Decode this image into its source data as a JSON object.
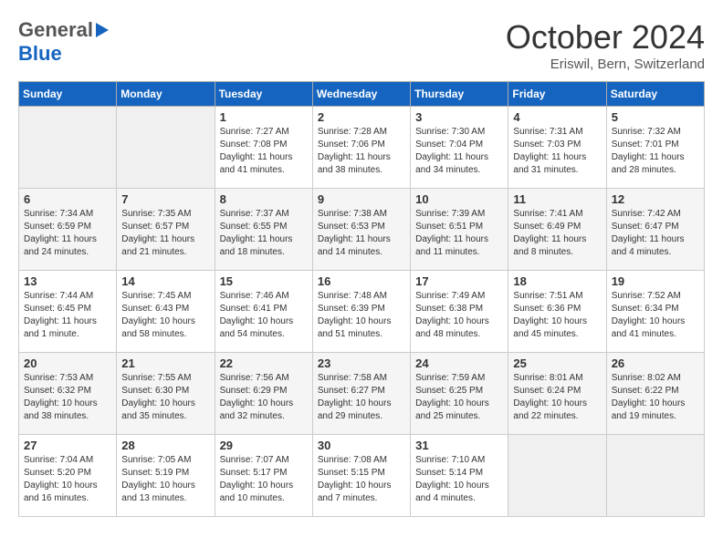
{
  "header": {
    "logo_general": "General",
    "logo_blue": "Blue",
    "month_title": "October 2024",
    "location": "Eriswil, Bern, Switzerland"
  },
  "days_of_week": [
    "Sunday",
    "Monday",
    "Tuesday",
    "Wednesday",
    "Thursday",
    "Friday",
    "Saturday"
  ],
  "weeks": [
    [
      {
        "day": "",
        "empty": true
      },
      {
        "day": "",
        "empty": true
      },
      {
        "day": "1",
        "sunrise": "Sunrise: 7:27 AM",
        "sunset": "Sunset: 7:08 PM",
        "daylight": "Daylight: 11 hours and 41 minutes."
      },
      {
        "day": "2",
        "sunrise": "Sunrise: 7:28 AM",
        "sunset": "Sunset: 7:06 PM",
        "daylight": "Daylight: 11 hours and 38 minutes."
      },
      {
        "day": "3",
        "sunrise": "Sunrise: 7:30 AM",
        "sunset": "Sunset: 7:04 PM",
        "daylight": "Daylight: 11 hours and 34 minutes."
      },
      {
        "day": "4",
        "sunrise": "Sunrise: 7:31 AM",
        "sunset": "Sunset: 7:03 PM",
        "daylight": "Daylight: 11 hours and 31 minutes."
      },
      {
        "day": "5",
        "sunrise": "Sunrise: 7:32 AM",
        "sunset": "Sunset: 7:01 PM",
        "daylight": "Daylight: 11 hours and 28 minutes."
      }
    ],
    [
      {
        "day": "6",
        "sunrise": "Sunrise: 7:34 AM",
        "sunset": "Sunset: 6:59 PM",
        "daylight": "Daylight: 11 hours and 24 minutes."
      },
      {
        "day": "7",
        "sunrise": "Sunrise: 7:35 AM",
        "sunset": "Sunset: 6:57 PM",
        "daylight": "Daylight: 11 hours and 21 minutes."
      },
      {
        "day": "8",
        "sunrise": "Sunrise: 7:37 AM",
        "sunset": "Sunset: 6:55 PM",
        "daylight": "Daylight: 11 hours and 18 minutes."
      },
      {
        "day": "9",
        "sunrise": "Sunrise: 7:38 AM",
        "sunset": "Sunset: 6:53 PM",
        "daylight": "Daylight: 11 hours and 14 minutes."
      },
      {
        "day": "10",
        "sunrise": "Sunrise: 7:39 AM",
        "sunset": "Sunset: 6:51 PM",
        "daylight": "Daylight: 11 hours and 11 minutes."
      },
      {
        "day": "11",
        "sunrise": "Sunrise: 7:41 AM",
        "sunset": "Sunset: 6:49 PM",
        "daylight": "Daylight: 11 hours and 8 minutes."
      },
      {
        "day": "12",
        "sunrise": "Sunrise: 7:42 AM",
        "sunset": "Sunset: 6:47 PM",
        "daylight": "Daylight: 11 hours and 4 minutes."
      }
    ],
    [
      {
        "day": "13",
        "sunrise": "Sunrise: 7:44 AM",
        "sunset": "Sunset: 6:45 PM",
        "daylight": "Daylight: 11 hours and 1 minute."
      },
      {
        "day": "14",
        "sunrise": "Sunrise: 7:45 AM",
        "sunset": "Sunset: 6:43 PM",
        "daylight": "Daylight: 10 hours and 58 minutes."
      },
      {
        "day": "15",
        "sunrise": "Sunrise: 7:46 AM",
        "sunset": "Sunset: 6:41 PM",
        "daylight": "Daylight: 10 hours and 54 minutes."
      },
      {
        "day": "16",
        "sunrise": "Sunrise: 7:48 AM",
        "sunset": "Sunset: 6:39 PM",
        "daylight": "Daylight: 10 hours and 51 minutes."
      },
      {
        "day": "17",
        "sunrise": "Sunrise: 7:49 AM",
        "sunset": "Sunset: 6:38 PM",
        "daylight": "Daylight: 10 hours and 48 minutes."
      },
      {
        "day": "18",
        "sunrise": "Sunrise: 7:51 AM",
        "sunset": "Sunset: 6:36 PM",
        "daylight": "Daylight: 10 hours and 45 minutes."
      },
      {
        "day": "19",
        "sunrise": "Sunrise: 7:52 AM",
        "sunset": "Sunset: 6:34 PM",
        "daylight": "Daylight: 10 hours and 41 minutes."
      }
    ],
    [
      {
        "day": "20",
        "sunrise": "Sunrise: 7:53 AM",
        "sunset": "Sunset: 6:32 PM",
        "daylight": "Daylight: 10 hours and 38 minutes."
      },
      {
        "day": "21",
        "sunrise": "Sunrise: 7:55 AM",
        "sunset": "Sunset: 6:30 PM",
        "daylight": "Daylight: 10 hours and 35 minutes."
      },
      {
        "day": "22",
        "sunrise": "Sunrise: 7:56 AM",
        "sunset": "Sunset: 6:29 PM",
        "daylight": "Daylight: 10 hours and 32 minutes."
      },
      {
        "day": "23",
        "sunrise": "Sunrise: 7:58 AM",
        "sunset": "Sunset: 6:27 PM",
        "daylight": "Daylight: 10 hours and 29 minutes."
      },
      {
        "day": "24",
        "sunrise": "Sunrise: 7:59 AM",
        "sunset": "Sunset: 6:25 PM",
        "daylight": "Daylight: 10 hours and 25 minutes."
      },
      {
        "day": "25",
        "sunrise": "Sunrise: 8:01 AM",
        "sunset": "Sunset: 6:24 PM",
        "daylight": "Daylight: 10 hours and 22 minutes."
      },
      {
        "day": "26",
        "sunrise": "Sunrise: 8:02 AM",
        "sunset": "Sunset: 6:22 PM",
        "daylight": "Daylight: 10 hours and 19 minutes."
      }
    ],
    [
      {
        "day": "27",
        "sunrise": "Sunrise: 7:04 AM",
        "sunset": "Sunset: 5:20 PM",
        "daylight": "Daylight: 10 hours and 16 minutes."
      },
      {
        "day": "28",
        "sunrise": "Sunrise: 7:05 AM",
        "sunset": "Sunset: 5:19 PM",
        "daylight": "Daylight: 10 hours and 13 minutes."
      },
      {
        "day": "29",
        "sunrise": "Sunrise: 7:07 AM",
        "sunset": "Sunset: 5:17 PM",
        "daylight": "Daylight: 10 hours and 10 minutes."
      },
      {
        "day": "30",
        "sunrise": "Sunrise: 7:08 AM",
        "sunset": "Sunset: 5:15 PM",
        "daylight": "Daylight: 10 hours and 7 minutes."
      },
      {
        "day": "31",
        "sunrise": "Sunrise: 7:10 AM",
        "sunset": "Sunset: 5:14 PM",
        "daylight": "Daylight: 10 hours and 4 minutes."
      },
      {
        "day": "",
        "empty": true
      },
      {
        "day": "",
        "empty": true
      }
    ]
  ]
}
